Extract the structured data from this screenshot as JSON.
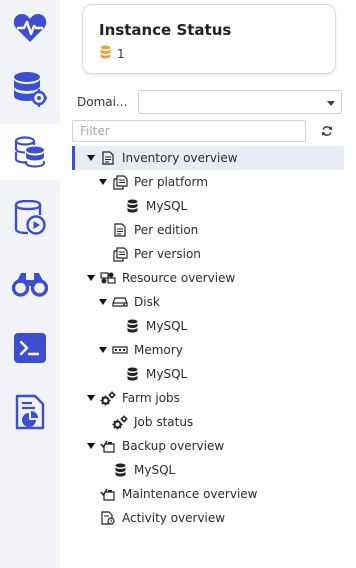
{
  "rail": {
    "items": [
      {
        "name": "health",
        "icon": "heart-pulse-icon"
      },
      {
        "name": "database-settings",
        "icon": "database-gear-icon"
      },
      {
        "name": "inventory",
        "icon": "stacked-databases-icon",
        "active": true
      },
      {
        "name": "backup",
        "icon": "database-play-icon"
      },
      {
        "name": "monitor",
        "icon": "binoculars-icon"
      },
      {
        "name": "console",
        "icon": "terminal-icon"
      },
      {
        "name": "reports",
        "icon": "report-chart-icon"
      }
    ],
    "accent_color": "#3d4fd1"
  },
  "status_card": {
    "title": "Instance Status",
    "count": "1",
    "count_icon_color": "#e8a23a"
  },
  "domain": {
    "label": "Domai...",
    "value": ""
  },
  "filter": {
    "placeholder": "Filter",
    "value": ""
  },
  "tree": {
    "selected_color": "#3d4fd1",
    "nodes": [
      {
        "label": "Inventory overview",
        "level": 0,
        "toggle": "expanded",
        "icon": "document-icon",
        "selected": true
      },
      {
        "label": "Per platform",
        "level": 1,
        "toggle": "expanded",
        "icon": "multi-document-icon"
      },
      {
        "label": "MySQL",
        "level": 2,
        "toggle": "none",
        "icon": "database-icon"
      },
      {
        "label": "Per edition",
        "level": 1,
        "toggle": "none",
        "icon": "document-icon"
      },
      {
        "label": "Per version",
        "level": 1,
        "toggle": "none",
        "icon": "multi-document-icon"
      },
      {
        "label": "Resource overview",
        "level": 0,
        "toggle": "expanded",
        "icon": "resource-icon"
      },
      {
        "label": "Disk",
        "level": 1,
        "toggle": "expanded",
        "icon": "disk-icon"
      },
      {
        "label": "MySQL",
        "level": 2,
        "toggle": "none",
        "icon": "database-icon"
      },
      {
        "label": "Memory",
        "level": 1,
        "toggle": "expanded",
        "icon": "memory-icon"
      },
      {
        "label": "MySQL",
        "level": 2,
        "toggle": "none",
        "icon": "database-icon"
      },
      {
        "label": "Farm jobs",
        "level": 0,
        "toggle": "expanded",
        "icon": "gears-icon"
      },
      {
        "label": "Job status",
        "level": 1,
        "toggle": "none",
        "icon": "gears-icon"
      },
      {
        "label": "Backup overview",
        "level": 0,
        "toggle": "expanded",
        "icon": "backup-check-icon"
      },
      {
        "label": "MySQL",
        "level": 1,
        "toggle": "none",
        "icon": "database-icon"
      },
      {
        "label": "Maintenance overview",
        "level": 0,
        "toggle": "none",
        "icon": "backup-check-icon"
      },
      {
        "label": "Activity overview",
        "level": 0,
        "toggle": "none",
        "icon": "activity-document-icon"
      }
    ]
  }
}
